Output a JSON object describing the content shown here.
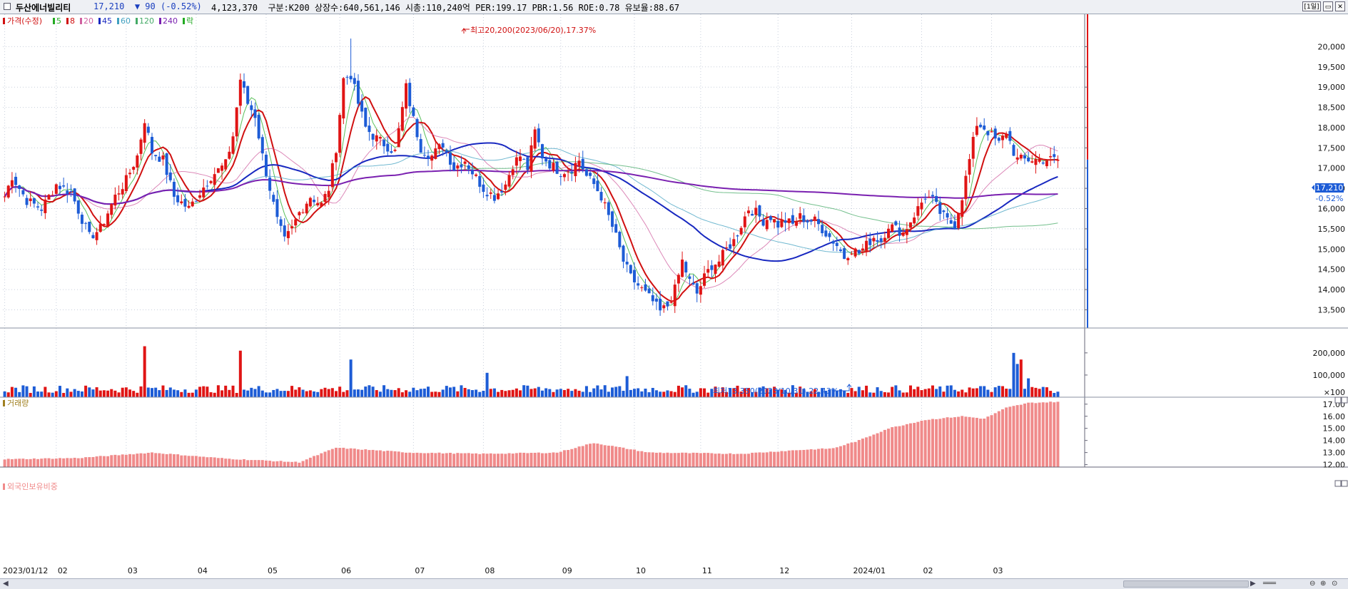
{
  "header": {
    "name": "두산에너빌리티",
    "price": "17,210",
    "change_arrow": "▼",
    "change": "90",
    "change_pct": "(-0.52%)",
    "stats": "4,123,370  구분:K200 상장수:640,561,146 시총:110,240억 PER:199.17 PBR:1.56 ROE:0.78 유보율:88.67",
    "period": "[1일]",
    "win_buttons": [
      "▭",
      "✕"
    ]
  },
  "legend": {
    "price_label": "가격(수정)",
    "ma": [
      {
        "label": "5",
        "color": "#22aa22"
      },
      {
        "label": "8",
        "color": "#d01010"
      },
      {
        "label": "20",
        "color": "#d060a0"
      },
      {
        "label": "45",
        "color": "#1828c0"
      },
      {
        "label": "60",
        "color": "#40a0c0"
      },
      {
        "label": "120",
        "color": "#44aa66"
      },
      {
        "label": "240",
        "color": "#7a20b0"
      }
    ],
    "rak": "락",
    "volume_label": "거래량",
    "foreign_label": "외국인보유비중"
  },
  "colors": {
    "up": "#e01515",
    "down": "#1d5cd6",
    "foreign": "#f08a8a",
    "grid": "#c8cfdc"
  },
  "annotations": {
    "high": "최고20,200(2023/06/20),17.37%",
    "low": "최저13,350(2023/10/31),22.43%",
    "last_price": "17,210",
    "last_pct": "-0.52%",
    "volume_unit": "×100"
  },
  "chart_data": [
    {
      "type": "candlestick",
      "title": "두산에너빌리티",
      "x_tick_labels": [
        "2023/01/12",
        "02",
        "03",
        "04",
        "05",
        "06",
        "07",
        "08",
        "09",
        "10",
        "11",
        "12",
        "2024/01",
        "02",
        "03"
      ],
      "y_tick_labels": [
        "20,000",
        "19,500",
        "19,000",
        "18,500",
        "18,000",
        "17,500",
        "17,000",
        "16,500",
        "16,000",
        "15,500",
        "15,000",
        "14,500",
        "14,000",
        "13,500"
      ],
      "ylim": [
        13050,
        20800
      ],
      "y_ticks": [
        20000,
        19500,
        19000,
        18500,
        18000,
        17500,
        17000,
        16500,
        16000,
        15500,
        15000,
        14500,
        14000,
        13500
      ],
      "close_anchors": [
        [
          0,
          16300
        ],
        [
          2,
          16800
        ],
        [
          6,
          16200
        ],
        [
          10,
          16000
        ],
        [
          14,
          16600
        ],
        [
          18,
          16400
        ],
        [
          23,
          15300
        ],
        [
          26,
          15500
        ],
        [
          30,
          16300
        ],
        [
          33,
          16700
        ],
        [
          36,
          17300
        ],
        [
          38,
          18200
        ],
        [
          40,
          17400
        ],
        [
          43,
          17200
        ],
        [
          46,
          16300
        ],
        [
          50,
          16000
        ],
        [
          53,
          16400
        ],
        [
          56,
          16800
        ],
        [
          60,
          17100
        ],
        [
          62,
          17800
        ],
        [
          64,
          19200
        ],
        [
          66,
          18600
        ],
        [
          68,
          18300
        ],
        [
          70,
          17300
        ],
        [
          72,
          16500
        ],
        [
          74,
          15700
        ],
        [
          76,
          15200
        ],
        [
          78,
          15500
        ],
        [
          80,
          15900
        ],
        [
          83,
          16300
        ],
        [
          86,
          16100
        ],
        [
          88,
          16500
        ],
        [
          90,
          17500
        ],
        [
          92,
          19200
        ],
        [
          94,
          19300
        ],
        [
          96,
          18600
        ],
        [
          98,
          18000
        ],
        [
          100,
          17800
        ],
        [
          103,
          17600
        ],
        [
          106,
          17400
        ],
        [
          109,
          19000
        ],
        [
          111,
          18200
        ],
        [
          113,
          17500
        ],
        [
          116,
          17300
        ],
        [
          119,
          17600
        ],
        [
          122,
          17000
        ],
        [
          125,
          17200
        ],
        [
          127,
          16900
        ],
        [
          130,
          16500
        ],
        [
          133,
          16300
        ],
        [
          136,
          16600
        ],
        [
          138,
          17100
        ],
        [
          140,
          17300
        ],
        [
          142,
          17000
        ],
        [
          144,
          17900
        ],
        [
          146,
          17300
        ],
        [
          148,
          17100
        ],
        [
          151,
          16900
        ],
        [
          154,
          17000
        ],
        [
          156,
          17200
        ],
        [
          158,
          16800
        ],
        [
          160,
          16600
        ],
        [
          162,
          16300
        ],
        [
          164,
          15800
        ],
        [
          166,
          15300
        ],
        [
          168,
          14700
        ],
        [
          170,
          14300
        ],
        [
          172,
          14100
        ],
        [
          174,
          13900
        ],
        [
          176,
          13700
        ],
        [
          178,
          13450
        ],
        [
          180,
          13600
        ],
        [
          182,
          14000
        ],
        [
          184,
          14700
        ],
        [
          186,
          14200
        ],
        [
          188,
          13900
        ],
        [
          190,
          14300
        ],
        [
          192,
          14600
        ],
        [
          194,
          14700
        ],
        [
          196,
          15000
        ],
        [
          198,
          15200
        ],
        [
          200,
          15600
        ],
        [
          202,
          16000
        ],
        [
          204,
          15900
        ],
        [
          206,
          15700
        ],
        [
          208,
          15800
        ],
        [
          210,
          15600
        ],
        [
          212,
          15700
        ],
        [
          214,
          15600
        ],
        [
          216,
          15800
        ],
        [
          218,
          15700
        ],
        [
          220,
          15700
        ],
        [
          222,
          15500
        ],
        [
          224,
          15300
        ],
        [
          226,
          15100
        ],
        [
          228,
          14800
        ],
        [
          230,
          15000
        ],
        [
          232,
          14900
        ],
        [
          234,
          15100
        ],
        [
          236,
          15300
        ],
        [
          238,
          15200
        ],
        [
          240,
          15600
        ],
        [
          242,
          15500
        ],
        [
          244,
          15400
        ],
        [
          246,
          15700
        ],
        [
          248,
          16000
        ],
        [
          250,
          16300
        ],
        [
          252,
          16200
        ],
        [
          254,
          15900
        ],
        [
          256,
          15700
        ],
        [
          258,
          15600
        ],
        [
          260,
          16300
        ],
        [
          262,
          17200
        ],
        [
          264,
          18100
        ],
        [
          266,
          18000
        ],
        [
          268,
          17800
        ],
        [
          270,
          17600
        ],
        [
          272,
          17900
        ],
        [
          274,
          17400
        ],
        [
          275,
          17210
        ]
      ],
      "series": [
        {
          "name": "5",
          "type": "sma",
          "period": 5,
          "color": "#22aa22"
        },
        {
          "name": "8",
          "type": "sma",
          "period": 8,
          "color": "#d01010"
        },
        {
          "name": "20",
          "type": "sma",
          "period": 20,
          "color": "#d060a0"
        },
        {
          "name": "45",
          "type": "sma",
          "period": 45,
          "color": "#1828c0"
        },
        {
          "name": "60",
          "type": "sma",
          "period": 60,
          "color": "#40a0c0"
        },
        {
          "name": "120",
          "type": "sma",
          "period": 120,
          "color": "#44aa66"
        },
        {
          "name": "240",
          "type": "sma",
          "period": 240,
          "color": "#7a20b0"
        }
      ],
      "high": {
        "value": 20200,
        "date": "2023/06/20"
      },
      "low": {
        "value": 13350,
        "date": "2023/10/31"
      },
      "last": {
        "value": 17210,
        "change_pct": -0.52
      }
    },
    {
      "type": "bar",
      "title": "거래량",
      "y_tick_labels": [
        "200,000",
        "100,000"
      ],
      "y_ticks": [
        200000,
        100000
      ],
      "ylim": [
        0,
        280000
      ],
      "unit": "×100",
      "base": 32000,
      "spikes": [
        [
          38,
          230000
        ],
        [
          64,
          210000
        ],
        [
          94,
          170000
        ],
        [
          131,
          110000
        ],
        [
          169,
          95000
        ],
        [
          274,
          200000
        ],
        [
          275,
          150000
        ],
        [
          276,
          170000
        ],
        [
          278,
          85000
        ]
      ]
    },
    {
      "type": "bar",
      "title": "외국인보유비중",
      "y_tick_labels": [
        "17.00",
        "16.00",
        "15.00",
        "14.00",
        "13.00",
        "12.00"
      ],
      "y_ticks": [
        17,
        16,
        15,
        14,
        13,
        12
      ],
      "ylim": [
        11.8,
        17.4
      ],
      "anchors": [
        [
          0,
          12.45
        ],
        [
          20,
          12.55
        ],
        [
          40,
          13.0
        ],
        [
          60,
          12.5
        ],
        [
          80,
          12.2
        ],
        [
          90,
          13.4
        ],
        [
          110,
          13.0
        ],
        [
          130,
          12.9
        ],
        [
          150,
          13.0
        ],
        [
          160,
          13.8
        ],
        [
          175,
          13.0
        ],
        [
          200,
          12.9
        ],
        [
          215,
          13.2
        ],
        [
          225,
          13.35
        ],
        [
          232,
          14.0
        ],
        [
          240,
          15.0
        ],
        [
          250,
          15.7
        ],
        [
          260,
          16.0
        ],
        [
          266,
          15.8
        ],
        [
          272,
          16.7
        ],
        [
          278,
          17.1
        ],
        [
          286,
          17.2
        ]
      ]
    }
  ]
}
